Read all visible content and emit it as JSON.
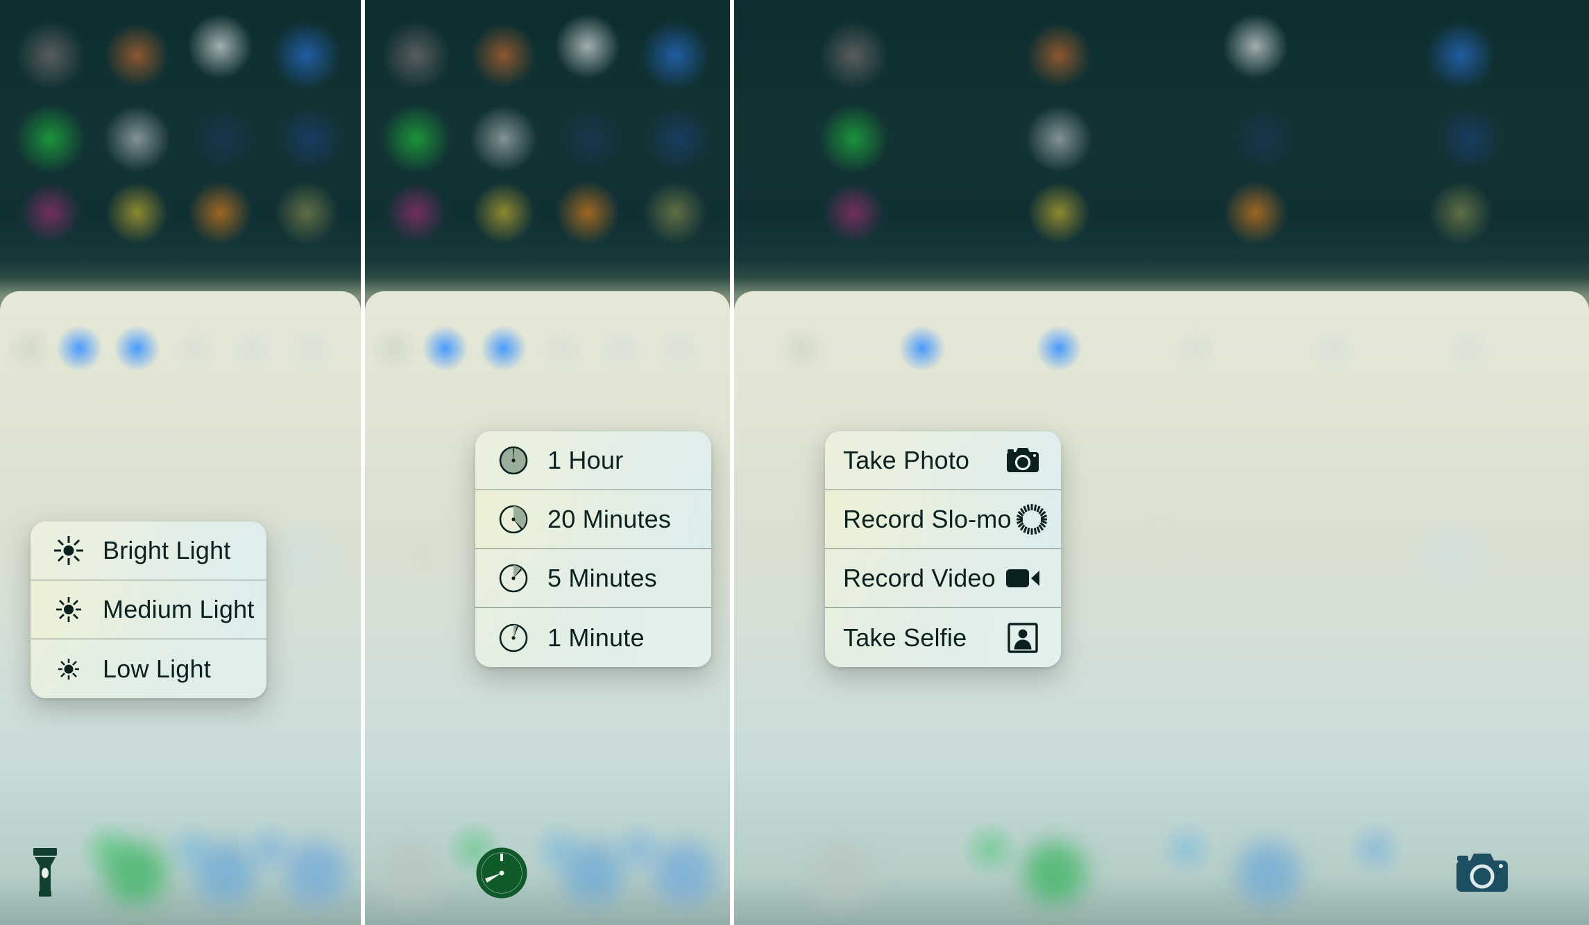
{
  "screenshot": {
    "description": "iOS Control Center 3D Touch quick-action menus — three phone screens side by side",
    "panel_count": 3
  },
  "colors": {
    "menu_text": "#0b211f",
    "menu_divider": "#14282380",
    "flashlight_icon": "#11402f",
    "timer_icon": "#0f5a28",
    "camera_icon": "#1d4f62",
    "control_toggle_blue": "#1e82ff",
    "wallpaper_dark": "#0d2e30"
  },
  "panels": [
    {
      "id": "flashlight-panel",
      "menu_name": "flashlight-quick-actions",
      "icon_side": "left",
      "shortcut_icon": "flashlight-icon",
      "shortcut_position": "left",
      "items": [
        {
          "label": "Bright Light",
          "icon": "brightness-high-icon"
        },
        {
          "label": "Medium Light",
          "icon": "brightness-medium-icon"
        },
        {
          "label": "Low Light",
          "icon": "brightness-low-icon"
        }
      ]
    },
    {
      "id": "timer-panel",
      "menu_name": "timer-quick-actions",
      "icon_side": "left",
      "shortcut_icon": "timer-icon",
      "shortcut_position": "center",
      "items": [
        {
          "label": "1 Hour",
          "icon": "timer-60-icon"
        },
        {
          "label": "20 Minutes",
          "icon": "timer-20-icon"
        },
        {
          "label": "5 Minutes",
          "icon": "timer-5-icon"
        },
        {
          "label": "1 Minute",
          "icon": "timer-1-icon"
        }
      ]
    },
    {
      "id": "camera-panel",
      "menu_name": "camera-quick-actions",
      "icon_side": "right",
      "shortcut_icon": "camera-icon",
      "shortcut_position": "right",
      "items": [
        {
          "label": "Take Photo",
          "icon": "camera-icon"
        },
        {
          "label": "Record Slo-mo",
          "icon": "slo-mo-icon"
        },
        {
          "label": "Record Video",
          "icon": "video-camera-icon"
        },
        {
          "label": "Take Selfie",
          "icon": "selfie-portrait-icon"
        }
      ]
    }
  ]
}
